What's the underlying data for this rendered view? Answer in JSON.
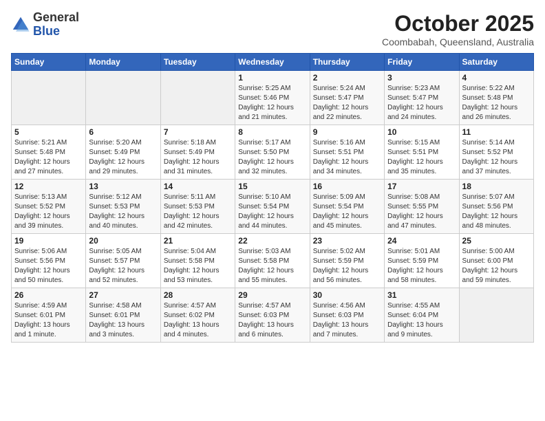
{
  "header": {
    "logo_general": "General",
    "logo_blue": "Blue",
    "month_title": "October 2025",
    "location": "Coombabah, Queensland, Australia"
  },
  "weekdays": [
    "Sunday",
    "Monday",
    "Tuesday",
    "Wednesday",
    "Thursday",
    "Friday",
    "Saturday"
  ],
  "weeks": [
    [
      {
        "day": "",
        "sunrise": "",
        "sunset": "",
        "daylight": ""
      },
      {
        "day": "",
        "sunrise": "",
        "sunset": "",
        "daylight": ""
      },
      {
        "day": "",
        "sunrise": "",
        "sunset": "",
        "daylight": ""
      },
      {
        "day": "1",
        "sunrise": "Sunrise: 5:25 AM",
        "sunset": "Sunset: 5:46 PM",
        "daylight": "Daylight: 12 hours and 21 minutes."
      },
      {
        "day": "2",
        "sunrise": "Sunrise: 5:24 AM",
        "sunset": "Sunset: 5:47 PM",
        "daylight": "Daylight: 12 hours and 22 minutes."
      },
      {
        "day": "3",
        "sunrise": "Sunrise: 5:23 AM",
        "sunset": "Sunset: 5:47 PM",
        "daylight": "Daylight: 12 hours and 24 minutes."
      },
      {
        "day": "4",
        "sunrise": "Sunrise: 5:22 AM",
        "sunset": "Sunset: 5:48 PM",
        "daylight": "Daylight: 12 hours and 26 minutes."
      }
    ],
    [
      {
        "day": "5",
        "sunrise": "Sunrise: 5:21 AM",
        "sunset": "Sunset: 5:48 PM",
        "daylight": "Daylight: 12 hours and 27 minutes."
      },
      {
        "day": "6",
        "sunrise": "Sunrise: 5:20 AM",
        "sunset": "Sunset: 5:49 PM",
        "daylight": "Daylight: 12 hours and 29 minutes."
      },
      {
        "day": "7",
        "sunrise": "Sunrise: 5:18 AM",
        "sunset": "Sunset: 5:49 PM",
        "daylight": "Daylight: 12 hours and 31 minutes."
      },
      {
        "day": "8",
        "sunrise": "Sunrise: 5:17 AM",
        "sunset": "Sunset: 5:50 PM",
        "daylight": "Daylight: 12 hours and 32 minutes."
      },
      {
        "day": "9",
        "sunrise": "Sunrise: 5:16 AM",
        "sunset": "Sunset: 5:51 PM",
        "daylight": "Daylight: 12 hours and 34 minutes."
      },
      {
        "day": "10",
        "sunrise": "Sunrise: 5:15 AM",
        "sunset": "Sunset: 5:51 PM",
        "daylight": "Daylight: 12 hours and 35 minutes."
      },
      {
        "day": "11",
        "sunrise": "Sunrise: 5:14 AM",
        "sunset": "Sunset: 5:52 PM",
        "daylight": "Daylight: 12 hours and 37 minutes."
      }
    ],
    [
      {
        "day": "12",
        "sunrise": "Sunrise: 5:13 AM",
        "sunset": "Sunset: 5:52 PM",
        "daylight": "Daylight: 12 hours and 39 minutes."
      },
      {
        "day": "13",
        "sunrise": "Sunrise: 5:12 AM",
        "sunset": "Sunset: 5:53 PM",
        "daylight": "Daylight: 12 hours and 40 minutes."
      },
      {
        "day": "14",
        "sunrise": "Sunrise: 5:11 AM",
        "sunset": "Sunset: 5:53 PM",
        "daylight": "Daylight: 12 hours and 42 minutes."
      },
      {
        "day": "15",
        "sunrise": "Sunrise: 5:10 AM",
        "sunset": "Sunset: 5:54 PM",
        "daylight": "Daylight: 12 hours and 44 minutes."
      },
      {
        "day": "16",
        "sunrise": "Sunrise: 5:09 AM",
        "sunset": "Sunset: 5:54 PM",
        "daylight": "Daylight: 12 hours and 45 minutes."
      },
      {
        "day": "17",
        "sunrise": "Sunrise: 5:08 AM",
        "sunset": "Sunset: 5:55 PM",
        "daylight": "Daylight: 12 hours and 47 minutes."
      },
      {
        "day": "18",
        "sunrise": "Sunrise: 5:07 AM",
        "sunset": "Sunset: 5:56 PM",
        "daylight": "Daylight: 12 hours and 48 minutes."
      }
    ],
    [
      {
        "day": "19",
        "sunrise": "Sunrise: 5:06 AM",
        "sunset": "Sunset: 5:56 PM",
        "daylight": "Daylight: 12 hours and 50 minutes."
      },
      {
        "day": "20",
        "sunrise": "Sunrise: 5:05 AM",
        "sunset": "Sunset: 5:57 PM",
        "daylight": "Daylight: 12 hours and 52 minutes."
      },
      {
        "day": "21",
        "sunrise": "Sunrise: 5:04 AM",
        "sunset": "Sunset: 5:58 PM",
        "daylight": "Daylight: 12 hours and 53 minutes."
      },
      {
        "day": "22",
        "sunrise": "Sunrise: 5:03 AM",
        "sunset": "Sunset: 5:58 PM",
        "daylight": "Daylight: 12 hours and 55 minutes."
      },
      {
        "day": "23",
        "sunrise": "Sunrise: 5:02 AM",
        "sunset": "Sunset: 5:59 PM",
        "daylight": "Daylight: 12 hours and 56 minutes."
      },
      {
        "day": "24",
        "sunrise": "Sunrise: 5:01 AM",
        "sunset": "Sunset: 5:59 PM",
        "daylight": "Daylight: 12 hours and 58 minutes."
      },
      {
        "day": "25",
        "sunrise": "Sunrise: 5:00 AM",
        "sunset": "Sunset: 6:00 PM",
        "daylight": "Daylight: 12 hours and 59 minutes."
      }
    ],
    [
      {
        "day": "26",
        "sunrise": "Sunrise: 4:59 AM",
        "sunset": "Sunset: 6:01 PM",
        "daylight": "Daylight: 13 hours and 1 minute."
      },
      {
        "day": "27",
        "sunrise": "Sunrise: 4:58 AM",
        "sunset": "Sunset: 6:01 PM",
        "daylight": "Daylight: 13 hours and 3 minutes."
      },
      {
        "day": "28",
        "sunrise": "Sunrise: 4:57 AM",
        "sunset": "Sunset: 6:02 PM",
        "daylight": "Daylight: 13 hours and 4 minutes."
      },
      {
        "day": "29",
        "sunrise": "Sunrise: 4:57 AM",
        "sunset": "Sunset: 6:03 PM",
        "daylight": "Daylight: 13 hours and 6 minutes."
      },
      {
        "day": "30",
        "sunrise": "Sunrise: 4:56 AM",
        "sunset": "Sunset: 6:03 PM",
        "daylight": "Daylight: 13 hours and 7 minutes."
      },
      {
        "day": "31",
        "sunrise": "Sunrise: 4:55 AM",
        "sunset": "Sunset: 6:04 PM",
        "daylight": "Daylight: 13 hours and 9 minutes."
      },
      {
        "day": "",
        "sunrise": "",
        "sunset": "",
        "daylight": ""
      }
    ]
  ]
}
